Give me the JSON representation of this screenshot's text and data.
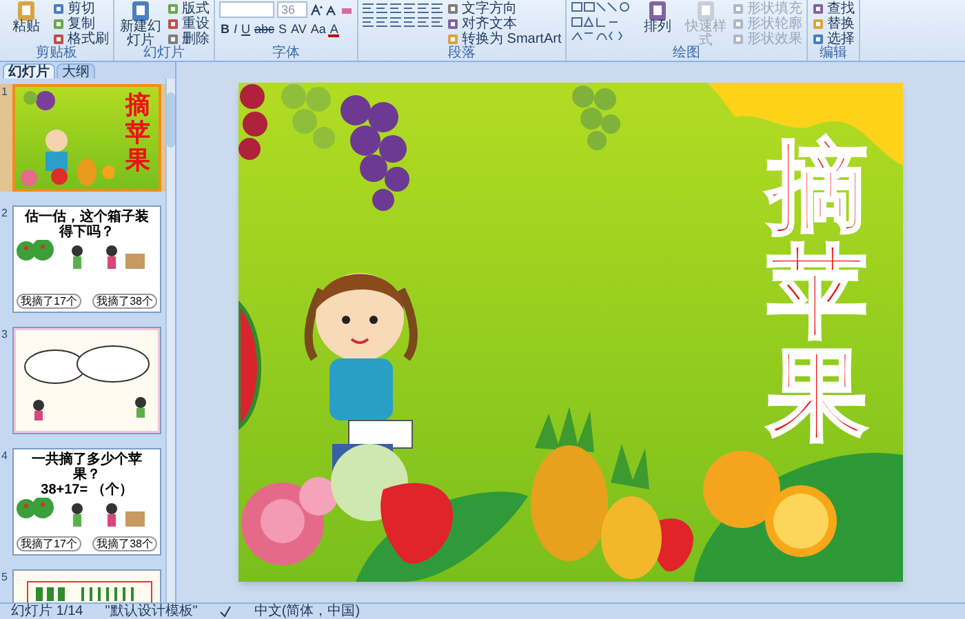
{
  "ribbon": {
    "groups": [
      {
        "label": "剪贴板",
        "items": [
          {
            "kind": "large",
            "label": "粘贴",
            "disabled": false
          },
          {
            "kind": "small",
            "label": "剪切",
            "disabled": false
          },
          {
            "kind": "small",
            "label": "复制",
            "disabled": false
          },
          {
            "kind": "small",
            "label": "格式刷",
            "disabled": false
          }
        ]
      },
      {
        "label": "幻灯片",
        "items": [
          {
            "kind": "large",
            "label": "新建幻灯片",
            "disabled": false
          },
          {
            "kind": "small",
            "label": "版式",
            "disabled": false
          },
          {
            "kind": "small",
            "label": "重设",
            "disabled": false
          },
          {
            "kind": "small",
            "label": "删除",
            "disabled": false
          }
        ]
      },
      {
        "label": "字体",
        "items": [
          {
            "kind": "font",
            "font_size": "36",
            "format_buttons": [
              "B",
              "I",
              "U",
              "abc",
              "S",
              "AV",
              "Aa",
              "A"
            ]
          }
        ]
      },
      {
        "label": "段落",
        "items": [
          {
            "kind": "paragraph"
          },
          {
            "kind": "small",
            "label": "文字方向",
            "disabled": false
          },
          {
            "kind": "small",
            "label": "对齐文本",
            "disabled": false
          },
          {
            "kind": "small",
            "label": "转换为 SmartArt",
            "disabled": false
          }
        ]
      },
      {
        "label": "绘图",
        "items": [
          {
            "kind": "gallery"
          },
          {
            "kind": "large",
            "label": "排列",
            "disabled": false
          },
          {
            "kind": "large",
            "label": "快速样式",
            "disabled": true
          },
          {
            "kind": "small",
            "label": "形状填充",
            "disabled": true
          },
          {
            "kind": "small",
            "label": "形状轮廓",
            "disabled": true
          },
          {
            "kind": "small",
            "label": "形状效果",
            "disabled": true
          }
        ]
      },
      {
        "label": "编辑",
        "items": [
          {
            "kind": "small",
            "label": "查找",
            "disabled": false
          },
          {
            "kind": "small",
            "label": "替换",
            "disabled": false
          },
          {
            "kind": "small",
            "label": "选择",
            "disabled": false
          }
        ]
      }
    ]
  },
  "pane": {
    "tabs": [
      {
        "label": "幻灯片",
        "selected": true
      },
      {
        "label": "大纲",
        "selected": false
      }
    ],
    "thumbnails": [
      {
        "number": "1",
        "kind": "title",
        "selected": true,
        "title": "摘苹果"
      },
      {
        "number": "2",
        "kind": "question",
        "selected": false,
        "heading": "估一估，这个箱子装得下吗？",
        "bubbles": [
          "我摘了17个",
          "我摘了38个"
        ]
      },
      {
        "number": "3",
        "kind": "clouds",
        "selected": false
      },
      {
        "number": "4",
        "kind": "question",
        "selected": false,
        "heading": "一共摘了多少个苹果？",
        "formula": "38+17= （个）",
        "bubbles": [
          "我摘了17个",
          "我摘了38个"
        ]
      },
      {
        "number": "5",
        "kind": "counting",
        "selected": false
      }
    ]
  },
  "slide": {
    "title": "摘苹果"
  },
  "status_bar": {
    "slide": "幻灯片 1/14",
    "theme": "\"默认设计模板\"",
    "language": "中文(简体，中国)"
  }
}
